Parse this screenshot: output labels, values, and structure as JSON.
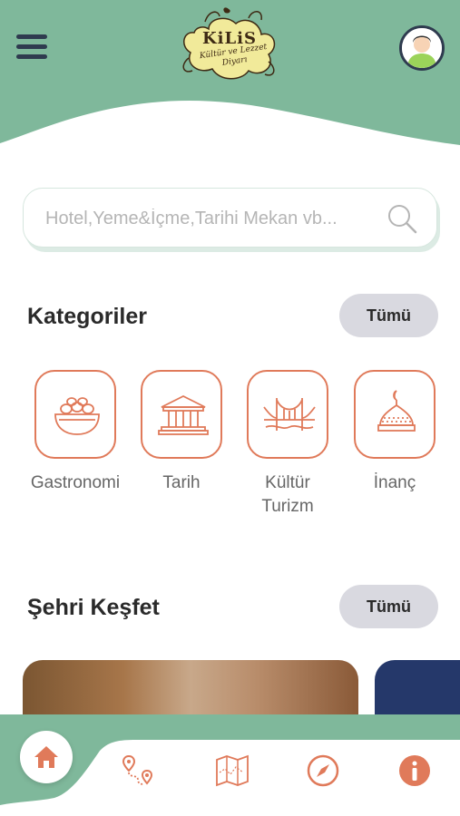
{
  "header": {
    "logo_main": "KiLiS",
    "logo_sub": "Kültür ve Lezzet Diyarı",
    "menu_icon": "hamburger-menu-icon",
    "avatar_icon": "user-avatar-icon"
  },
  "search": {
    "placeholder": "Hotel,Yeme&İçme,Tarihi Mekan vb...",
    "icon": "search-icon"
  },
  "categories_section": {
    "title": "Kategoriler",
    "all_label": "Tümü",
    "items": [
      {
        "label": "Gastronomi",
        "icon": "food-bowl-icon"
      },
      {
        "label": "Tarih",
        "icon": "museum-icon"
      },
      {
        "label": "Kültür\nTurizm",
        "label_line1": "Kültür",
        "label_line2": "Turizm",
        "icon": "bridge-icon"
      },
      {
        "label": "İnanç",
        "icon": "mosque-dome-icon"
      }
    ]
  },
  "explore_section": {
    "title": "Şehri Keşfet",
    "all_label": "Tümü"
  },
  "bottom_nav": {
    "items": [
      "home-icon",
      "route-icon",
      "map-icon",
      "compass-icon",
      "info-icon"
    ]
  },
  "colors": {
    "header_green": "#7fb89b",
    "accent_orange": "#e07a5a",
    "dark_navy": "#2f3b4f",
    "button_gray": "#d9d9e0"
  }
}
